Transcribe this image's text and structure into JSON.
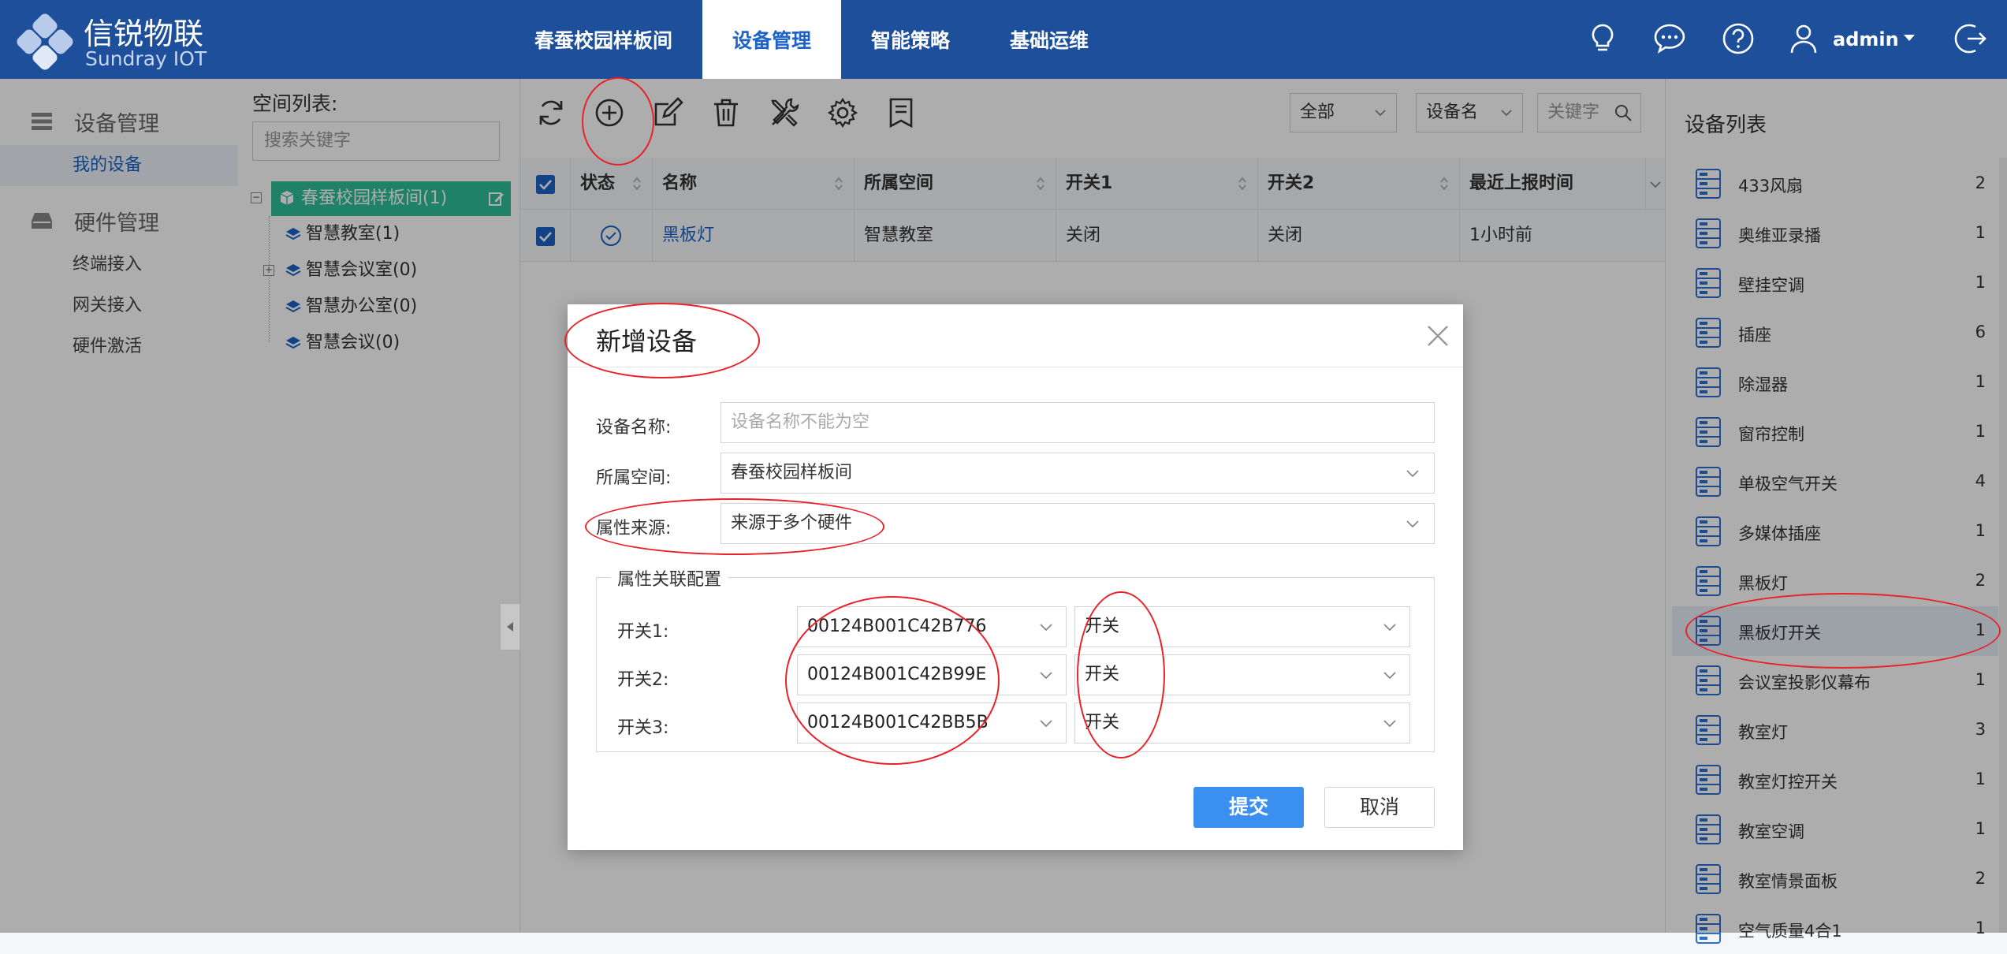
{
  "brand": {
    "name": "信锐物联",
    "sub": "Sundray IOT"
  },
  "nav": {
    "tabs": [
      "春蚕校园样板间",
      "设备管理",
      "智能策略",
      "基础运维"
    ],
    "active_index": 1
  },
  "user": {
    "name": "admin"
  },
  "leftmenu": {
    "groups": [
      {
        "label": "设备管理",
        "icon": "list-icon",
        "items": [
          "我的设备"
        ]
      },
      {
        "label": "硬件管理",
        "icon": "hardware-icon",
        "items": [
          "终端接入",
          "网关接入",
          "硬件激活"
        ]
      }
    ],
    "active_item": "我的设备"
  },
  "space": {
    "title": "空间列表:",
    "search_placeholder": "搜索关键字",
    "root": "春蚕校园样板间(1)",
    "children": [
      "智慧教室(1)",
      "智慧会议室(0)",
      "智慧办公室(0)",
      "智慧会议(0)"
    ]
  },
  "toolbar": {
    "filter_all": "全部",
    "filter_field": "设备名",
    "keyword_placeholder": "关键字"
  },
  "table": {
    "columns": [
      "状态",
      "名称",
      "所属空间",
      "开关1",
      "开关2",
      "最近上报时间"
    ],
    "rows": [
      {
        "name": "黑板灯",
        "space": "智慧教室",
        "switch1": "关闭",
        "switch2": "关闭",
        "reported": "1小时前"
      }
    ]
  },
  "devicelist": {
    "title": "设备列表",
    "items": [
      {
        "name": "433风扇",
        "count": "2"
      },
      {
        "name": "奥维亚录播",
        "count": "1"
      },
      {
        "name": "壁挂空调",
        "count": "1"
      },
      {
        "name": "插座",
        "count": "6"
      },
      {
        "name": "除湿器",
        "count": "1"
      },
      {
        "name": "窗帘控制",
        "count": "1"
      },
      {
        "name": "单极空气开关",
        "count": "4"
      },
      {
        "name": "多媒体插座",
        "count": "1"
      },
      {
        "name": "黑板灯",
        "count": "2"
      },
      {
        "name": "黑板灯开关",
        "count": "1"
      },
      {
        "name": "会议室投影仪幕布",
        "count": "1"
      },
      {
        "name": "教室灯",
        "count": "3"
      },
      {
        "name": "教室灯控开关",
        "count": "1"
      },
      {
        "name": "教室空调",
        "count": "1"
      },
      {
        "name": "教室情景面板",
        "count": "2"
      },
      {
        "name": "空气质量4合1",
        "count": "1"
      }
    ],
    "active_item": "黑板灯开关"
  },
  "dialog": {
    "title": "新增设备",
    "name_label": "设备名称:",
    "name_placeholder": "设备名称不能为空",
    "space_label": "所属空间:",
    "space_value": "春蚕校园样板间",
    "source_label": "属性来源:",
    "source_value": "来源于多个硬件",
    "group_title": "属性关联配置",
    "bindings": [
      {
        "label": "开关1:",
        "hardware": "00124B001C42B776",
        "attr": "开关"
      },
      {
        "label": "开关2:",
        "hardware": "00124B001C42B99E",
        "attr": "开关"
      },
      {
        "label": "开关3:",
        "hardware": "00124B001C42BB5B",
        "attr": "开关"
      }
    ],
    "submit": "提交",
    "cancel": "取消"
  },
  "colors": {
    "header": "#1d4f9a",
    "accent": "#1d63c8",
    "tree_active": "#2fbf97",
    "submit": "#3b8ff0",
    "annotation": "#e8222a"
  }
}
